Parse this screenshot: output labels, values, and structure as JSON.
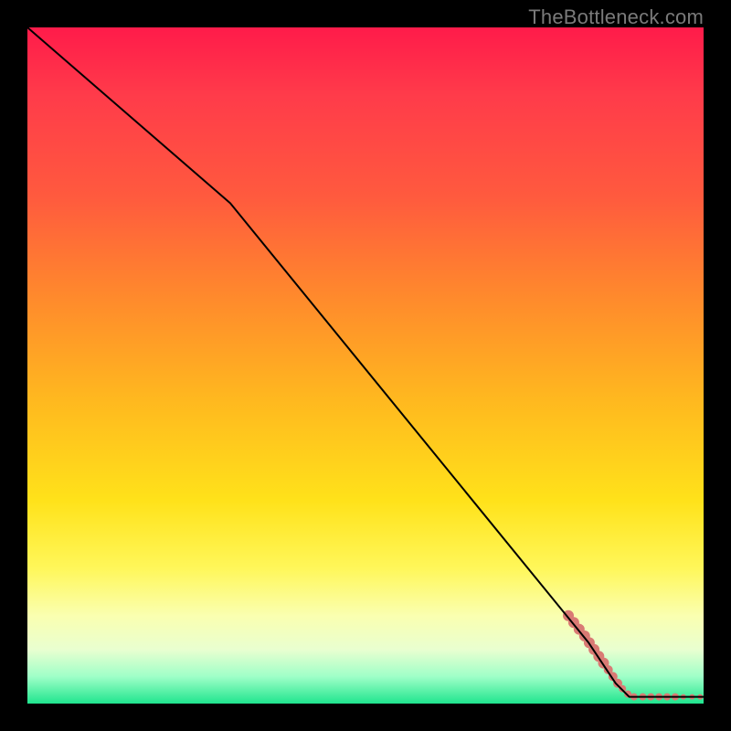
{
  "attribution": "TheBottleneck.com",
  "colors": {
    "background": "#000000",
    "curve": "#000000",
    "marker": "#d97a74"
  },
  "chart_data": {
    "type": "line",
    "title": "",
    "xlabel": "",
    "ylabel": "",
    "xlim": [
      0,
      100
    ],
    "ylim": [
      0,
      100
    ],
    "grid": false,
    "legend": false,
    "series": [
      {
        "name": "curve",
        "type": "line",
        "points": [
          {
            "x": 0,
            "y": 100
          },
          {
            "x": 30,
            "y": 74
          },
          {
            "x": 83,
            "y": 9
          },
          {
            "x": 87,
            "y": 3
          },
          {
            "x": 89,
            "y": 1
          },
          {
            "x": 100,
            "y": 1
          }
        ]
      },
      {
        "name": "markers",
        "type": "scatter",
        "points": [
          {
            "x": 80.0,
            "y": 13.0,
            "r": 6
          },
          {
            "x": 80.8,
            "y": 12.0,
            "r": 6
          },
          {
            "x": 81.6,
            "y": 11.0,
            "r": 6
          },
          {
            "x": 82.4,
            "y": 10.0,
            "r": 6
          },
          {
            "x": 83.1,
            "y": 9.0,
            "r": 6
          },
          {
            "x": 83.8,
            "y": 8.0,
            "r": 6
          },
          {
            "x": 84.5,
            "y": 7.0,
            "r": 6
          },
          {
            "x": 85.2,
            "y": 6.0,
            "r": 6
          },
          {
            "x": 85.9,
            "y": 5.0,
            "r": 5
          },
          {
            "x": 86.6,
            "y": 4.0,
            "r": 5
          },
          {
            "x": 87.3,
            "y": 3.0,
            "r": 5
          },
          {
            "x": 88.0,
            "y": 2.2,
            "r": 4
          },
          {
            "x": 88.8,
            "y": 1.4,
            "r": 4
          },
          {
            "x": 89.7,
            "y": 1.0,
            "r": 4
          },
          {
            "x": 91.0,
            "y": 1.0,
            "r": 4
          },
          {
            "x": 92.2,
            "y": 1.0,
            "r": 4
          },
          {
            "x": 93.4,
            "y": 1.0,
            "r": 4
          },
          {
            "x": 94.6,
            "y": 1.0,
            "r": 4
          },
          {
            "x": 95.8,
            "y": 1.0,
            "r": 4
          },
          {
            "x": 97.0,
            "y": 1.0,
            "r": 3
          },
          {
            "x": 98.3,
            "y": 1.0,
            "r": 3
          },
          {
            "x": 99.5,
            "y": 1.0,
            "r": 3
          }
        ]
      }
    ]
  }
}
